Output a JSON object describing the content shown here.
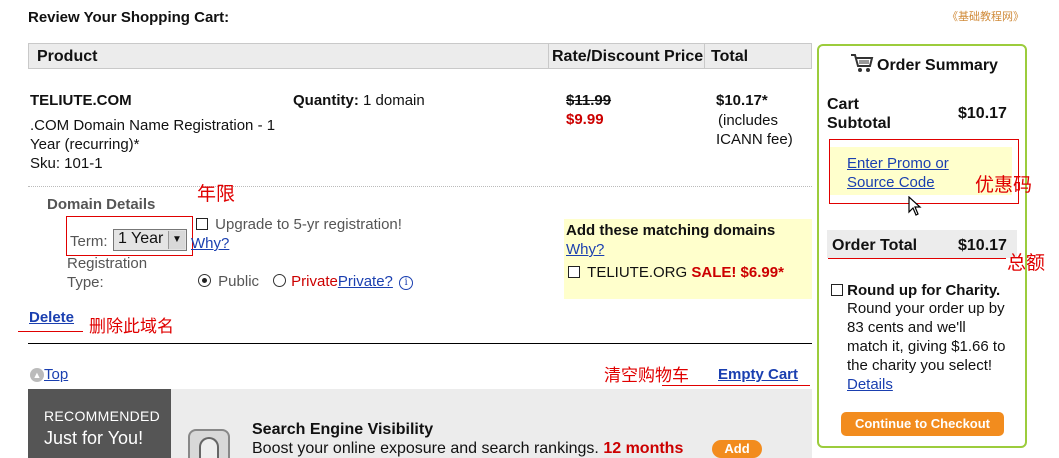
{
  "page": {
    "title": "Review Your Shopping Cart:",
    "watermark": "《基础教程网》"
  },
  "table": {
    "headers": [
      "Product",
      "Rate/Discount Price",
      "Total"
    ]
  },
  "item": {
    "name": "TELIUTE.COM",
    "description_line1": ".COM Domain Name Registration - 1",
    "description_line2": "Year (recurring)*",
    "sku": "Sku: 101-1",
    "quantity_label": "Quantity:",
    "quantity_value": "1 domain",
    "old_price": "$11.99",
    "new_price": "$9.99",
    "total": "$10.17*",
    "total_note_1": "(includes",
    "total_note_2": "ICANN fee)"
  },
  "domain_details": {
    "heading": "Domain Details",
    "term_label": "Term:",
    "term_value": "1 Year",
    "upgrade_label": "Upgrade to 5-yr registration!",
    "why_link": "Why?",
    "registration_label_1": "Registration",
    "registration_label_2": "Type:",
    "public_label": "Public",
    "private_label": "Private",
    "private_link": "Private?",
    "info_icon_glyph": "i",
    "delete_link": "Delete"
  },
  "matching": {
    "heading": "Add these matching domains",
    "why_link": "Why?",
    "domain": "TELIUTE.ORG",
    "sale": "SALE! $6.99*"
  },
  "links": {
    "top": "Top",
    "empty_cart": "Empty Cart"
  },
  "recommended": {
    "badge_line1": "RECOMMENDED",
    "badge_line2": "Just for You!",
    "product_title": "Search Engine Visibility",
    "product_desc": "Boost your online exposure and search rankings.",
    "product_term": "12 months",
    "add_label": "Add"
  },
  "order_summary": {
    "title": "Order Summary",
    "subtotal_label_1": "Cart",
    "subtotal_label_2": "Subtotal",
    "subtotal_value": "$10.17",
    "promo_line1": "Enter Promo or",
    "promo_line2": "Source Code",
    "total_label": "Order Total",
    "total_value": "$10.17",
    "charity_title": "Round up for Charity.",
    "charity_text_1": "Round your order up by",
    "charity_text_2": "83 cents and we'll",
    "charity_text_3": "match it, giving $1.66 to",
    "charity_text_4": "the charity you select!",
    "details_link": "Details",
    "checkout_label": "Continue to Checkout"
  },
  "annotations": {
    "term": "年限",
    "delete": "删除此域名",
    "promo": "优惠码",
    "total": "总额",
    "empty_cart": "清空购物车"
  },
  "colors": {
    "annotation_red": "#e00000",
    "link_blue": "#1a3fb0",
    "sale_red": "#cc0000",
    "highlight_yellow": "#ffffcc",
    "summary_border_green": "#9ccc3c",
    "button_orange": "#f28c1e"
  }
}
